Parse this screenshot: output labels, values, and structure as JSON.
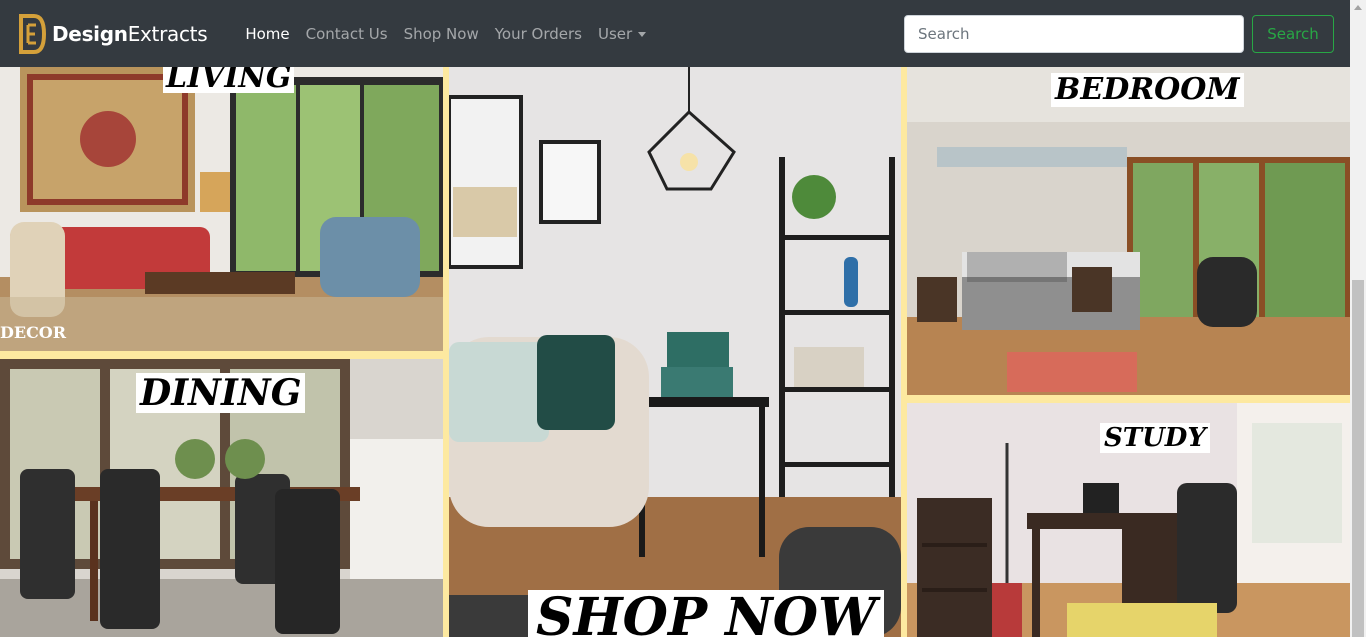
{
  "brand": {
    "part1": "Design",
    "part2": "Extracts",
    "logo_icon": "design-extracts-logo-icon"
  },
  "nav": {
    "items": [
      {
        "label": "Home",
        "active": true
      },
      {
        "label": "Contact Us",
        "active": false
      },
      {
        "label": "Shop Now",
        "active": false
      },
      {
        "label": "Your Orders",
        "active": false
      }
    ],
    "user_label": "User"
  },
  "search": {
    "placeholder": "Search",
    "value": "",
    "button_label": "Search"
  },
  "tiles": {
    "living": {
      "label": "LIVING",
      "watermark": "DECOR"
    },
    "dining": {
      "label": "DINING"
    },
    "shop": {
      "label": "SHOP NOW"
    },
    "bedroom": {
      "label": "BEDROOM"
    },
    "study": {
      "label": "STUDY"
    }
  },
  "colors": {
    "navbar": "#343a40",
    "tile_border": "#fde9a0",
    "search_green": "#28a745",
    "brand_gold": "#d4a03a"
  }
}
